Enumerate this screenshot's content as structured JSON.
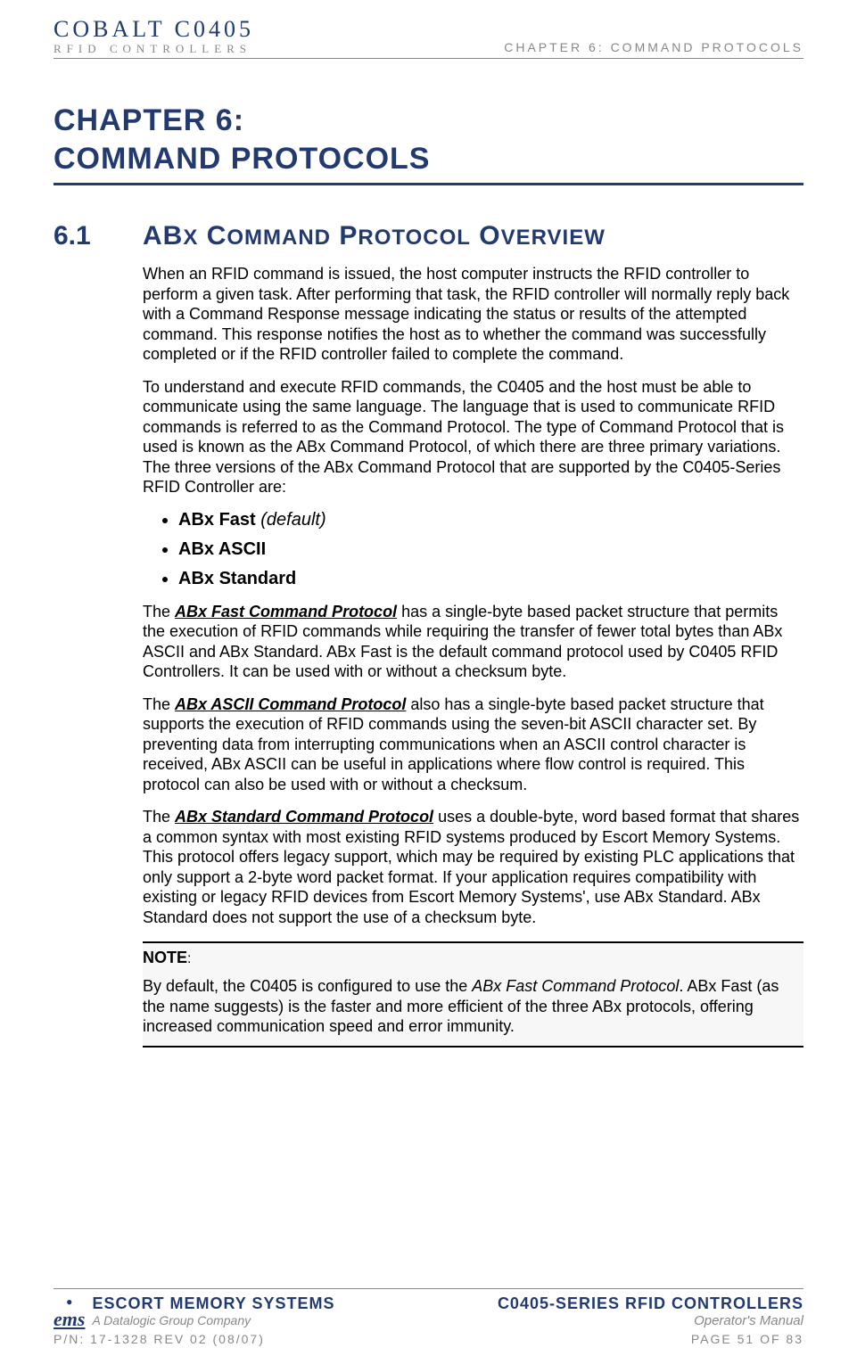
{
  "header": {
    "brand_line1_a": "COBALT",
    "brand_line1_b": "C0405",
    "brand_line2": "RFID CONTROLLERS",
    "chapter_label": "CHAPTER 6: COMMAND PROTOCOLS"
  },
  "chapter_title_line1": "CHAPTER 6:",
  "chapter_title_line2": "COMMAND PROTOCOLS",
  "section": {
    "number": "6.1",
    "heading_word1": "AB",
    "heading_word1b": "X",
    "heading_word2": " C",
    "heading_word2b": "OMMAND",
    "heading_word3": " P",
    "heading_word3b": "ROTOCOL",
    "heading_word4": " O",
    "heading_word4b": "VERVIEW"
  },
  "p1": "When an RFID command is issued, the host computer instructs the RFID controller to perform a given task. After performing that task, the RFID controller will normally reply back with a Command Response message indicating the status or results of the attempted command. This response notifies the host as to whether the command was successfully completed or if the RFID controller failed to complete the command.",
  "p2": "To understand and execute RFID commands, the C0405 and the host must be able to communicate using the same language. The language that is used to communicate RFID commands is referred to as the Command Protocol. The type of Command Protocol that is used is known as the ABx Command Protocol, of which there are three primary variations. The three versions of the ABx Command Protocol that are supported by the C0405-Series RFID Controller are:",
  "bullets": {
    "b1a": "ABx Fast",
    "b1b": " (",
    "b1c": "default",
    "b1d": ")",
    "b2": "ABx ASCII",
    "b3": "ABx Standard"
  },
  "p3a": "The ",
  "p3b": "ABx Fast Command Protocol",
  "p3c": " has a single-byte based packet structure that permits the execution of RFID commands while requiring the transfer of fewer total bytes than ABx ASCII and ABx Standard. ABx Fast is the default command protocol used by C0405 RFID Controllers. It can be used with or without a checksum byte.",
  "p4a": "The ",
  "p4b": "ABx ASCII Command Protocol",
  "p4c": " also has a single-byte based packet structure that supports the execution of RFID commands using the seven-bit ASCII character set. By preventing data from interrupting communications when an ASCII control character is received, ABx ASCII can be useful in applications where flow control is required. This protocol can also be used with or without a checksum.",
  "p5a": "The ",
  "p5b": "ABx Standard Command Protocol",
  "p5c": " uses a double-byte, word based format that shares a common syntax with most existing RFID systems produced by Escort Memory Systems. This protocol offers legacy support, which may be required by existing PLC applications that only support a 2-byte word packet format. If your application requires compatibility with existing or legacy RFID devices from Escort Memory Systems', use ABx Standard. ABx Standard does not support the use of a checksum byte.",
  "note": {
    "label": "NOTE",
    "colon": ":",
    "body_a": "By default, the C0405 is configured to use the ",
    "body_b": "ABx Fast Command Protocol",
    "body_c": ". ABx Fast (as the name suggests) is the faster and more efficient of the three ABx protocols, offering increased communication speed and error immunity."
  },
  "footer": {
    "left_l1": "ESCORT MEMORY SYSTEMS",
    "left_l2": "A Datalogic Group Company",
    "right_l1": "C0405-SERIES RFID CONTROLLERS",
    "right_l2": "Operator's Manual",
    "pn": "P/N: 17-1328 REV 02 (08/07)",
    "page": "PAGE 51 OF 83",
    "ems": "ems"
  }
}
